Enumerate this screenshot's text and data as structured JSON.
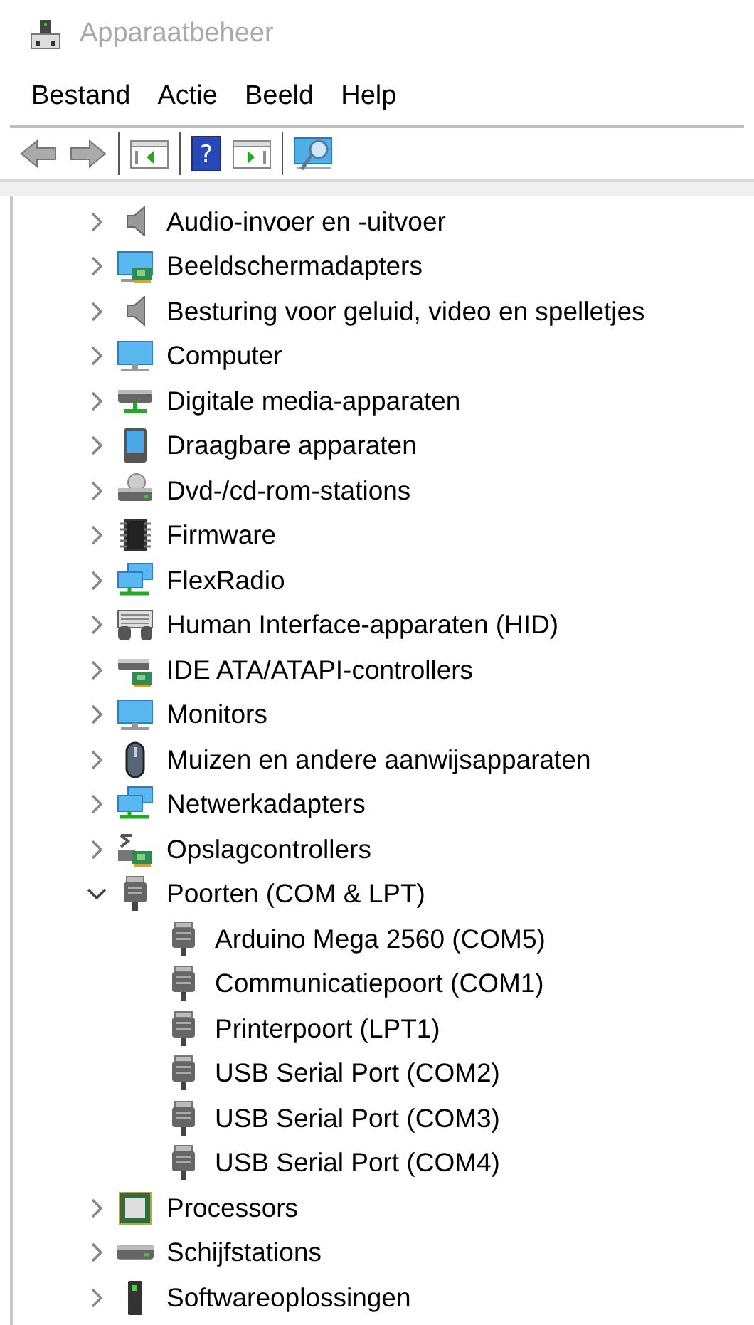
{
  "window": {
    "title": "Apparaatbeheer"
  },
  "menu": [
    "Bestand",
    "Actie",
    "Beeld",
    "Help"
  ],
  "toolbar": {
    "help_glyph": "?"
  },
  "tree": [
    {
      "label": "Audio-invoer en -uitvoer",
      "expanded": false
    },
    {
      "label": "Beeldschermadapters",
      "expanded": false
    },
    {
      "label": "Besturing voor geluid, video en spelletjes",
      "expanded": false
    },
    {
      "label": "Computer",
      "expanded": false
    },
    {
      "label": "Digitale media-apparaten",
      "expanded": false
    },
    {
      "label": "Draagbare apparaten",
      "expanded": false
    },
    {
      "label": "Dvd-/cd-rom-stations",
      "expanded": false
    },
    {
      "label": "Firmware",
      "expanded": false
    },
    {
      "label": "FlexRadio",
      "expanded": false
    },
    {
      "label": "Human Interface-apparaten (HID)",
      "expanded": false
    },
    {
      "label": "IDE ATA/ATAPI-controllers",
      "expanded": false
    },
    {
      "label": "Monitors",
      "expanded": false
    },
    {
      "label": "Muizen en andere aanwijsapparaten",
      "expanded": false
    },
    {
      "label": "Netwerkadapters",
      "expanded": false
    },
    {
      "label": "Opslagcontrollers",
      "expanded": false
    },
    {
      "label": "Poorten (COM & LPT)",
      "expanded": true,
      "children": [
        {
          "label": "Arduino Mega 2560 (COM5)"
        },
        {
          "label": "Communicatiepoort (COM1)"
        },
        {
          "label": "Printerpoort (LPT1)"
        },
        {
          "label": "USB Serial Port (COM2)"
        },
        {
          "label": "USB Serial Port (COM3)"
        },
        {
          "label": "USB Serial Port (COM4)"
        }
      ]
    },
    {
      "label": "Processors",
      "expanded": false
    },
    {
      "label": "Schijfstations",
      "expanded": false
    },
    {
      "label": "Softwareoplossingen",
      "expanded": false
    }
  ]
}
